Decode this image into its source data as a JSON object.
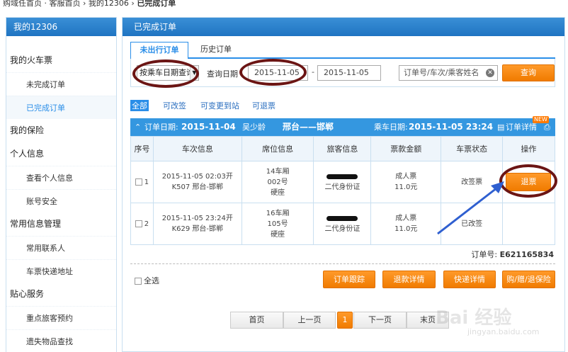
{
  "breadcrumb": {
    "path_left": "购域任首页 · 客服首页",
    "sep1": "›",
    "mid": "我的12306",
    "sep2": "›",
    "current": "已完成订单"
  },
  "sidebar": {
    "header": "我的12306",
    "sections": [
      {
        "title": "我的火车票",
        "items": [
          "未完成订单",
          "已完成订单"
        ]
      },
      {
        "title": "我的保险",
        "items": []
      },
      {
        "title": "个人信息",
        "items": [
          "查看个人信息",
          "账号安全"
        ]
      },
      {
        "title": "常用信息管理",
        "items": [
          "常用联系人",
          "车票快递地址"
        ]
      },
      {
        "title": "贴心服务",
        "items": [
          "重点旅客预约",
          "遗失物品查找"
        ]
      }
    ]
  },
  "main": {
    "header": "已完成订单",
    "tabs": [
      "未出行订单",
      "历史订单"
    ],
    "search": {
      "query_type": "按乘车日期查询",
      "date_label": "查询日期",
      "date_from": "2015-11-05",
      "date_sep": "-",
      "date_to": "2015-11-05",
      "keyword_placeholder": "订单号/车次/乘客姓名",
      "query_button": "查询"
    },
    "filters": [
      "全部",
      "可改签",
      "可变更到站",
      "可退票"
    ],
    "order": {
      "order_date_label": "订单日期:",
      "order_date": "2015-11-04",
      "passenger_name": "吴少龄",
      "route": "邢台——邯郸",
      "ride_date_label": "乘车日期:",
      "ride_date": "2015-11-05 23:24",
      "detail_link": "订单详情",
      "new_badge": "NEW",
      "columns": [
        "序号",
        "车次信息",
        "席位信息",
        "旅客信息",
        "票款金额",
        "车票状态",
        "操作"
      ],
      "rows": [
        {
          "no": "1",
          "time": "2015-11-05 02:03开",
          "train": "K507 邢台-邯郸",
          "car": "14车厢",
          "seat": "002号",
          "seat_type": "硬座",
          "id_type": "二代身份证",
          "ticket_type": "成人票",
          "price": "11.0元",
          "status": "改签票",
          "action": "退票"
        },
        {
          "no": "2",
          "time": "2015-11-05 23:24开",
          "train": "K629 邢台-邯郸",
          "car": "16车厢",
          "seat": "105号",
          "seat_type": "硬座",
          "id_type": "二代身份证",
          "ticket_type": "成人票",
          "price": "11.0元",
          "status": "已改签",
          "action": ""
        }
      ],
      "order_no_label": "订单号:",
      "order_no": "E621165834",
      "select_all": "全选",
      "actions": [
        "订单跟踪",
        "退款详情",
        "快递详情",
        "购/赠/退保险"
      ]
    },
    "pager": {
      "first": "首页",
      "prev": "上一页",
      "current": "1",
      "next": "下一页",
      "last": "末页"
    }
  },
  "watermark": {
    "text": "Bai 经验",
    "sub": "jingyan.baidu.com"
  },
  "colors": {
    "header_blue": "#2a8ee8",
    "accent_orange": "#f07b00",
    "annotation_dark_red": "#6b1514",
    "arrow_blue": "#2f5fd0"
  }
}
